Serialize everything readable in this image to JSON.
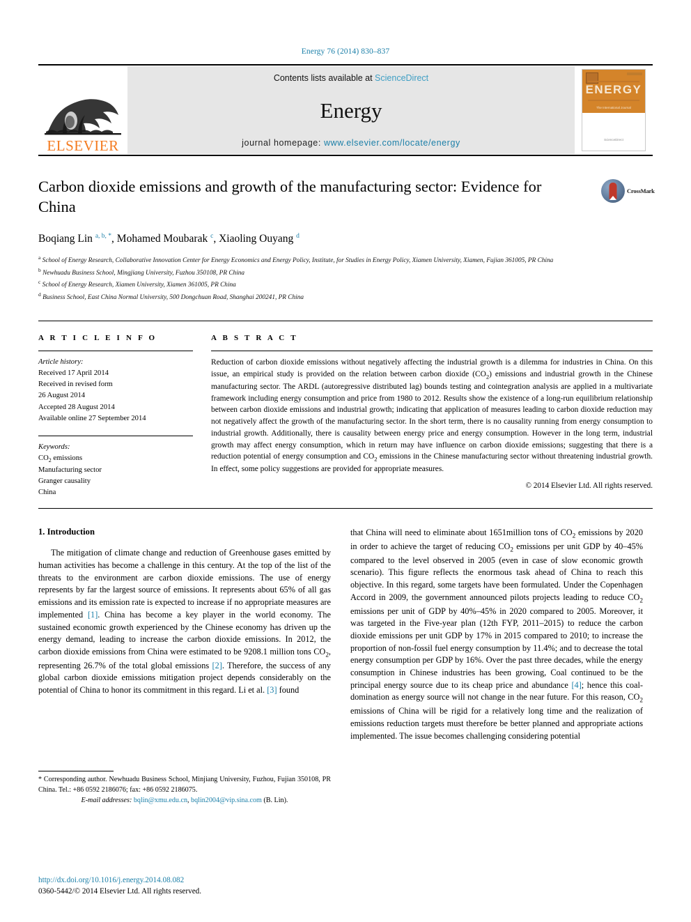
{
  "header": {
    "journal_ref": "Energy 76 (2014) 830–837"
  },
  "masthead": {
    "elsevier_wordmark": "ELSEVIER",
    "contents_prefix": "Contents lists available at ",
    "sciencedirect": "ScienceDirect",
    "journal_name": "Energy",
    "homepage_prefix": "journal homepage: ",
    "homepage_url": "www.elsevier.com/locate/energy",
    "cover_title": "ENERGY",
    "cover_subtitle": "The International Journal"
  },
  "article": {
    "title": "Carbon dioxide emissions and growth of the manufacturing sector: Evidence for China",
    "crossmark_label": "CrossMark",
    "authors_html": "Boqiang Lin <sup>a, b, *</sup>, Mohamed Moubarak <sup>c</sup>, Xiaoling Ouyang <sup>d</sup>",
    "affiliations": [
      {
        "marker": "a",
        "text": "School of Energy Research, Collaborative Innovation Center for Energy Economics and Energy Policy, Institute, for Studies in Energy Policy, Xiamen University, Xiamen, Fujian 361005, PR China"
      },
      {
        "marker": "b",
        "text": "Newhuadu Business School, Mingjiang University, Fuzhou 350108, PR China"
      },
      {
        "marker": "c",
        "text": "School of Energy Research, Xiamen University, Xiamen 361005, PR China"
      },
      {
        "marker": "d",
        "text": "Business School, East China Normal University, 500 Dongchuan Road, Shanghai 200241, PR China"
      }
    ]
  },
  "article_info": {
    "heading": "A R T I C L E  I N F O",
    "history_label": "Article history:",
    "history": [
      "Received 17 April 2014",
      "Received in revised form",
      "26 August 2014",
      "Accepted 28 August 2014",
      "Available online 27 September 2014"
    ],
    "keywords_label": "Keywords:",
    "keywords": [
      "CO2 emissions",
      "Manufacturing sector",
      "Granger causality",
      "China"
    ]
  },
  "abstract": {
    "heading": "A B S T R A C T",
    "text": "Reduction of carbon dioxide emissions without negatively affecting the industrial growth is a dilemma for industries in China. On this issue, an empirical study is provided on the relation between carbon dioxide (CO2) emissions and industrial growth in the Chinese manufacturing sector. The ARDL (autoregressive distributed lag) bounds testing and cointegration analysis are applied in a multivariate framework including energy consumption and price from 1980 to 2012. Results show the existence of a long-run equilibrium relationship between carbon dioxide emissions and industrial growth; indicating that application of measures leading to carbon dioxide reduction may not negatively affect the growth of the manufacturing sector. In the short term, there is no causality running from energy consumption to industrial growth. Additionally, there is causality between energy price and energy consumption. However in the long term, industrial growth may affect energy consumption, which in return may have influence on carbon dioxide emissions; suggesting that there is a reduction potential of energy consumption and CO2 emissions in the Chinese manufacturing sector without threatening industrial growth. In effect, some policy suggestions are provided for appropriate measures.",
    "copyright": "© 2014 Elsevier Ltd. All rights reserved."
  },
  "introduction": {
    "heading": "1. Introduction",
    "left_paragraph_1": "The mitigation of climate change and reduction of Greenhouse gases emitted by human activities has become a challenge in this century. At the top of the list of the threats to the environment are carbon dioxide emissions. The use of energy represents by far the largest source of emissions. It represents about 65% of all gas emissions and its emission rate is expected to increase if no appropriate measures are implemented ",
    "left_cite_1": "[1]",
    "left_paragraph_2": ". China has become a key player in the world economy. The sustained economic growth experienced by the Chinese economy has driven up the energy demand, leading to increase the carbon dioxide emissions. In 2012, the carbon dioxide emissions from China were estimated to be 9208.1 million tons CO2, representing 26.7% of the total global emissions ",
    "left_cite_2": "[2]",
    "left_paragraph_3": ". Therefore, the success of any global carbon dioxide emissions mitigation project depends considerably on the potential of China to honor its commitment in this regard. Li et al. ",
    "left_cite_3": "[3]",
    "left_paragraph_4": " found",
    "right_paragraph_1": "that China will need to eliminate about 1651million tons of CO2 emissions by 2020 in order to achieve the target of reducing CO2 emissions per unit GDP by 40–45% compared to the level observed in 2005 (even in case of slow economic growth scenario). This figure reflects the enormous task ahead of China to reach this objective. In this regard, some targets have been formulated. Under the Copenhagen Accord in 2009, the government announced pilots projects leading to reduce CO2 emissions per unit of GDP by 40%–45% in 2020 compared to 2005. Moreover, it was targeted in the Five-year plan (12th FYP, 2011–2015) to reduce the carbon dioxide emissions per unit GDP by 17% in 2015 compared to 2010; to increase the proportion of non-fossil fuel energy consumption by 11.4%; and to decrease the total energy consumption per GDP by 16%. Over the past three decades, while the energy consumption in Chinese industries has been growing, Coal continued to be the principal energy source due to its cheap price and abundance ",
    "right_cite_1": "[4]",
    "right_paragraph_2": "; hence this coal-domination as energy source will not change in the near future. For this reason, CO2 emissions of China will be rigid for a relatively long time and the realization of emissions reduction targets must therefore be better planned and appropriate actions implemented. The issue becomes challenging considering potential"
  },
  "footnote": {
    "corresponding": "* Corresponding author. Newhuadu Business School, Minjiang University, Fuzhou, Fujian 350108, PR China. Tel.: +86 0592 2186076; fax: +86 0592 2186075.",
    "email_label": "E-mail addresses:",
    "email_1": "bqlin@xmu.edu.cn",
    "email_2": "bqlin2004@vip.sina.com",
    "email_suffix": "(B. Lin)."
  },
  "bottom": {
    "doi": "http://dx.doi.org/10.1016/j.energy.2014.08.082",
    "issn": "0360-5442/© 2014 Elsevier Ltd. All rights reserved."
  },
  "colors": {
    "link_blue": "#1b7fa8",
    "elsevier_orange": "#F47B20",
    "sciencedirect_blue": "#3f9fc4",
    "cover_orange": "#d4842a"
  }
}
